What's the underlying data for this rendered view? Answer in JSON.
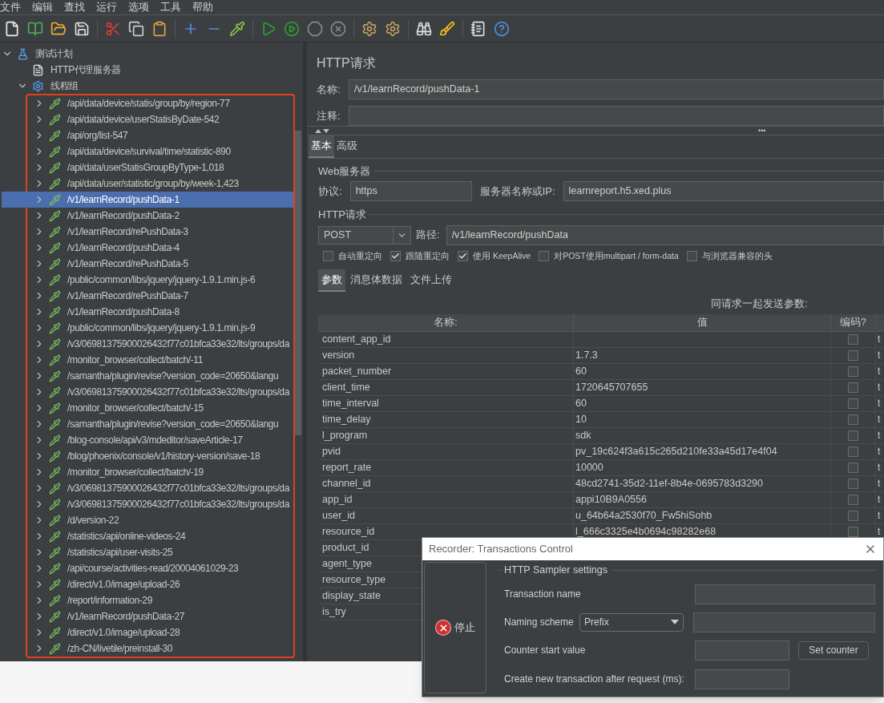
{
  "menu": [
    "文件",
    "编辑",
    "查找",
    "运行",
    "选项",
    "工具",
    "帮助"
  ],
  "tree": [
    {
      "label": "测试计划",
      "kind": "plan",
      "expanded": true,
      "selected": false,
      "children": [
        {
          "label": "HTTP代理服务器",
          "kind": "proxy",
          "selected": false
        },
        {
          "label": "线程组",
          "kind": "thread_group",
          "expanded": true,
          "selected": false,
          "children": [
            {
              "label": "/api/data/device/statis/group/by/region-77",
              "kind": "sampler",
              "expanded": false,
              "selected": false
            },
            {
              "label": "/api/data/device/userStatisByDate-542",
              "kind": "sampler",
              "expanded": false,
              "selected": false
            },
            {
              "label": "/api/org/list-547",
              "kind": "sampler",
              "expanded": false,
              "selected": false
            },
            {
              "label": "/api/data/device/survival/time/statistic-890",
              "kind": "sampler",
              "expanded": false,
              "selected": false
            },
            {
              "label": "/api/data/userStatisGroupByType-1,018",
              "kind": "sampler",
              "expanded": false,
              "selected": false
            },
            {
              "label": "/api/data/user/statistic/group/by/week-1,423",
              "kind": "sampler",
              "expanded": false,
              "selected": false
            },
            {
              "label": "/v1/learnRecord/pushData-1",
              "kind": "sampler",
              "expanded": false,
              "selected": true
            },
            {
              "label": "/v1/learnRecord/pushData-2",
              "kind": "sampler",
              "expanded": false,
              "selected": false
            },
            {
              "label": "/v1/learnRecord/rePushData-3",
              "kind": "sampler",
              "expanded": false,
              "selected": false
            },
            {
              "label": "/v1/learnRecord/pushData-4",
              "kind": "sampler",
              "expanded": false,
              "selected": false
            },
            {
              "label": "/v1/learnRecord/rePushData-5",
              "kind": "sampler",
              "expanded": false,
              "selected": false
            },
            {
              "label": "/public/common/libs/jquery/jquery-1.9.1.min.js-6",
              "kind": "sampler",
              "expanded": false,
              "selected": false
            },
            {
              "label": "/v1/learnRecord/rePushData-7",
              "kind": "sampler",
              "expanded": false,
              "selected": false
            },
            {
              "label": "/v1/learnRecord/pushData-8",
              "kind": "sampler",
              "expanded": false,
              "selected": false
            },
            {
              "label": "/public/common/libs/jquery/jquery-1.9.1.min.js-9",
              "kind": "sampler",
              "expanded": false,
              "selected": false
            },
            {
              "label": "/v3/06981375900026432f77c01bfca33e32/lts/groups/da",
              "kind": "sampler",
              "expanded": false,
              "selected": false
            },
            {
              "label": "/monitor_browser/collect/batch/-11",
              "kind": "sampler",
              "expanded": false,
              "selected": false
            },
            {
              "label": "/samantha/plugin/revise?version_code=20650&langu",
              "kind": "sampler",
              "expanded": false,
              "selected": false
            },
            {
              "label": "/v3/06981375900026432f77c01bfca33e32/lts/groups/da",
              "kind": "sampler",
              "expanded": false,
              "selected": false
            },
            {
              "label": "/monitor_browser/collect/batch/-15",
              "kind": "sampler",
              "expanded": false,
              "selected": false
            },
            {
              "label": "/samantha/plugin/revise?version_code=20650&langu",
              "kind": "sampler",
              "expanded": false,
              "selected": false
            },
            {
              "label": "/blog-console/api/v3/mdeditor/saveArticle-17",
              "kind": "sampler",
              "expanded": false,
              "selected": false
            },
            {
              "label": "/blog/phoenix/console/v1/history-version/save-18",
              "kind": "sampler",
              "expanded": false,
              "selected": false
            },
            {
              "label": "/monitor_browser/collect/batch/-19",
              "kind": "sampler",
              "expanded": false,
              "selected": false
            },
            {
              "label": "/v3/06981375900026432f77c01bfca33e32/lts/groups/da",
              "kind": "sampler",
              "expanded": false,
              "selected": false
            },
            {
              "label": "/v3/06981375900026432f77c01bfca33e32/lts/groups/da",
              "kind": "sampler",
              "expanded": false,
              "selected": false
            },
            {
              "label": "/d/version-22",
              "kind": "sampler",
              "expanded": false,
              "selected": false
            },
            {
              "label": "/statistics/api/online-videos-24",
              "kind": "sampler",
              "expanded": false,
              "selected": false
            },
            {
              "label": "/statistics/api/user-visits-25",
              "kind": "sampler",
              "expanded": false,
              "selected": false
            },
            {
              "label": "/api/course/activities-read/20004061029-23",
              "kind": "sampler",
              "expanded": false,
              "selected": false
            },
            {
              "label": "/direct/v1.0/image/upload-26",
              "kind": "sampler",
              "expanded": false,
              "selected": false
            },
            {
              "label": "/report/information-29",
              "kind": "sampler",
              "expanded": false,
              "selected": false
            },
            {
              "label": "/v1/learnRecord/pushData-27",
              "kind": "sampler",
              "expanded": false,
              "selected": false
            },
            {
              "label": "/direct/v1.0/image/upload-28",
              "kind": "sampler",
              "expanded": false,
              "selected": false
            },
            {
              "label": "/zh-CN/livetile/preinstall-30",
              "kind": "sampler",
              "expanded": false,
              "selected": false
            }
          ]
        }
      ]
    }
  ],
  "panel": {
    "title": "HTTP请求",
    "name_label": "名称:",
    "name_value": "/v1/learnRecord/pushData-1",
    "comment_label": "注释:",
    "splitter_dots": "•••",
    "tabs": [
      {
        "label": "基本",
        "selected": true
      },
      {
        "label": "高级",
        "selected": false
      }
    ],
    "web_server": {
      "title": "Web服务器",
      "protocol_label": "协议:",
      "protocol_value": "https",
      "server_label": "服务器名称或IP:",
      "server_value": "learnreport.h5.xed.plus"
    },
    "http_request": {
      "title": "HTTP请求",
      "method": "POST",
      "path_label": "路径:",
      "path_value": "/v1/learnRecord/pushData"
    },
    "options": [
      {
        "label": "自动重定向",
        "checked": false
      },
      {
        "label": "跟随重定向",
        "checked": true
      },
      {
        "label": "使用 KeepAlive",
        "checked": true
      },
      {
        "label": "对POST使用multipart / form-data",
        "checked": false
      },
      {
        "label": "与浏览器兼容的头",
        "checked": false
      }
    ],
    "subtabs": [
      {
        "label": "参数",
        "selected": true
      },
      {
        "label": "消息体数据",
        "selected": false
      },
      {
        "label": "文件上传",
        "selected": false
      }
    ],
    "params_caption": "同请求一起发送参数:",
    "columns": [
      "名称:",
      "值",
      "编码?"
    ],
    "rows": [
      {
        "name": "content_app_id",
        "encode": false,
        "column_4": "t"
      },
      {
        "name": "version",
        "value": "1.7.3",
        "encode": false,
        "column_4": "t"
      },
      {
        "name": "packet_number",
        "value": "60",
        "encode": false,
        "column_4": "t"
      },
      {
        "name": "client_time",
        "value": "1720645707655",
        "encode": false,
        "column_4": "t"
      },
      {
        "name": "time_interval",
        "value": "60",
        "encode": false,
        "column_4": "t"
      },
      {
        "name": "time_delay",
        "value": "10",
        "encode": false,
        "column_4": "t"
      },
      {
        "name": "l_program",
        "value": "sdk",
        "encode": false,
        "column_4": "t"
      },
      {
        "name": "pvid",
        "value": "pv_19c624f3a615c265d210fe33a45d17e4f04",
        "encode": false,
        "column_4": "t"
      },
      {
        "name": "report_rate",
        "value": "10000",
        "encode": false,
        "column_4": "t"
      },
      {
        "name": "channel_id",
        "value": "48cd2741-35d2-11ef-8b4e-0695783d3290",
        "encode": false,
        "column_4": "t"
      },
      {
        "name": "app_id",
        "value": "appi10B9A0556",
        "encode": false,
        "column_4": "t"
      },
      {
        "name": "user_id",
        "value": "u_64b64a2530f70_Fw5hiSohb",
        "encode": false,
        "column_4": "t"
      },
      {
        "name": "resource_id",
        "value": "l_666c3325e4b0694c98282e68",
        "encode": false,
        "column_4": "t"
      },
      {
        "name": "product_id"
      },
      {
        "name": "agent_type"
      },
      {
        "name": "resource_type"
      },
      {
        "name": "display_state"
      },
      {
        "name": "is_try"
      }
    ]
  },
  "dialog": {
    "title": "Recorder: Transactions Control",
    "stop_label": "停止",
    "group_title": "HTTP Sampler settings",
    "transaction_name_label": "Transaction name",
    "naming_scheme_label": "Naming scheme",
    "naming_scheme_value": "Prefix",
    "counter_label": "Counter start value",
    "set_counter": "Set counter",
    "create_after_label": "Create new transaction after request (ms):"
  }
}
